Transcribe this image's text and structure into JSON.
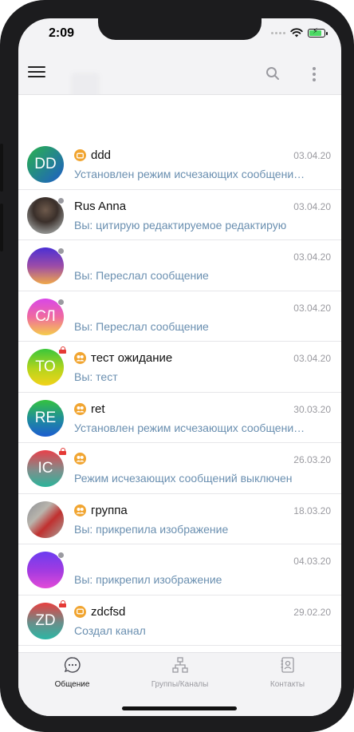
{
  "status_bar": {
    "time": "2:09"
  },
  "colors": {
    "accent": "#f1a531",
    "preview_text": "#6a8fb0",
    "active_tab": "#1a1a1a",
    "inactive_tab": "#9a9aa0"
  },
  "app_bar": {
    "menu_icon": "hamburger-icon",
    "search_icon": "search-icon",
    "more_icon": "more-vertical-icon"
  },
  "chats": [
    {
      "name": "ddd",
      "date": "03.04.20",
      "preview": "Установлен режим исчезающих сообщени…",
      "avatar_text": "DD",
      "badge": "channel"
    },
    {
      "name": "Rus Anna",
      "date": "03.04.20",
      "preview": "Вы: цитирую редактируемое редактирую",
      "avatar_text": "",
      "badge": ""
    },
    {
      "name": "",
      "date": "03.04.20",
      "preview": "Вы: Переслал сообщение",
      "avatar_text": "",
      "badge": ""
    },
    {
      "name": "",
      "date": "03.04.20",
      "preview": "Вы: Переслал сообщение",
      "avatar_text": "СЛ",
      "badge": ""
    },
    {
      "name": "тест ожидание",
      "date": "03.04.20",
      "preview": "Вы: тест",
      "avatar_text": "ТО",
      "badge": "group"
    },
    {
      "name": "ret",
      "date": "30.03.20",
      "preview": "Установлен режим исчезающих сообщени…",
      "avatar_text": "RE",
      "badge": "group"
    },
    {
      "name": "",
      "date": "26.03.20",
      "preview": "Режим исчезающих сообщений выключен",
      "avatar_text": "IC",
      "badge": "group"
    },
    {
      "name": "группа",
      "date": "18.03.20",
      "preview": "Вы: прикрепила изображение",
      "avatar_text": "",
      "badge": "group"
    },
    {
      "name": "",
      "date": "04.03.20",
      "preview": "Вы: прикрепил изображение",
      "avatar_text": "",
      "badge": ""
    },
    {
      "name": "zdcfsd",
      "date": "29.02.20",
      "preview": "Создал канал",
      "avatar_text": "ZD",
      "badge": "channel"
    }
  ],
  "tabs": [
    {
      "label": "Общение",
      "icon": "chat-bubble-icon",
      "active": true
    },
    {
      "label": "Группы/Каналы",
      "icon": "network-icon",
      "active": false
    },
    {
      "label": "Контакты",
      "icon": "contacts-book-icon",
      "active": false
    }
  ]
}
